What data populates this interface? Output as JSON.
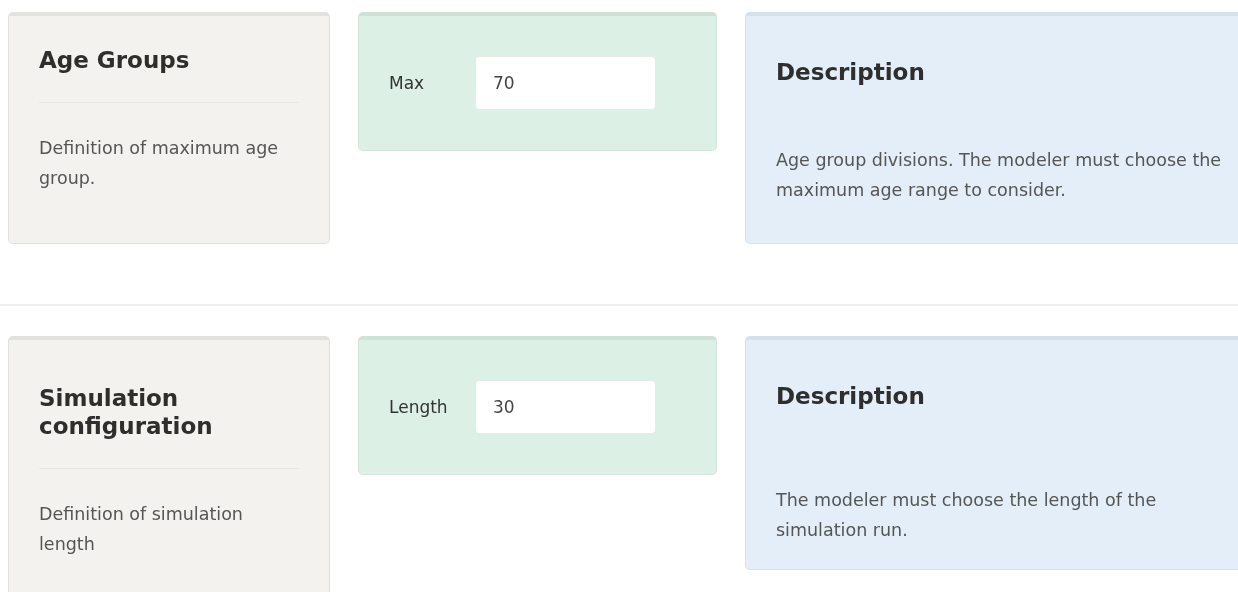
{
  "sections": [
    {
      "title": "Age Groups",
      "summary": "Definition of maximum age group.",
      "field": {
        "label": "Max",
        "value": "70"
      },
      "description": {
        "title": "Description",
        "text": "Age group divisions. The modeler must choose the maximum age range to consider."
      }
    },
    {
      "title": "Simulation configuration",
      "summary": "Definition of simulation length",
      "field": {
        "label": "Length",
        "value": "30"
      },
      "description": {
        "title": "Description",
        "text": "The modeler must choose the length of the simulation run."
      }
    }
  ]
}
